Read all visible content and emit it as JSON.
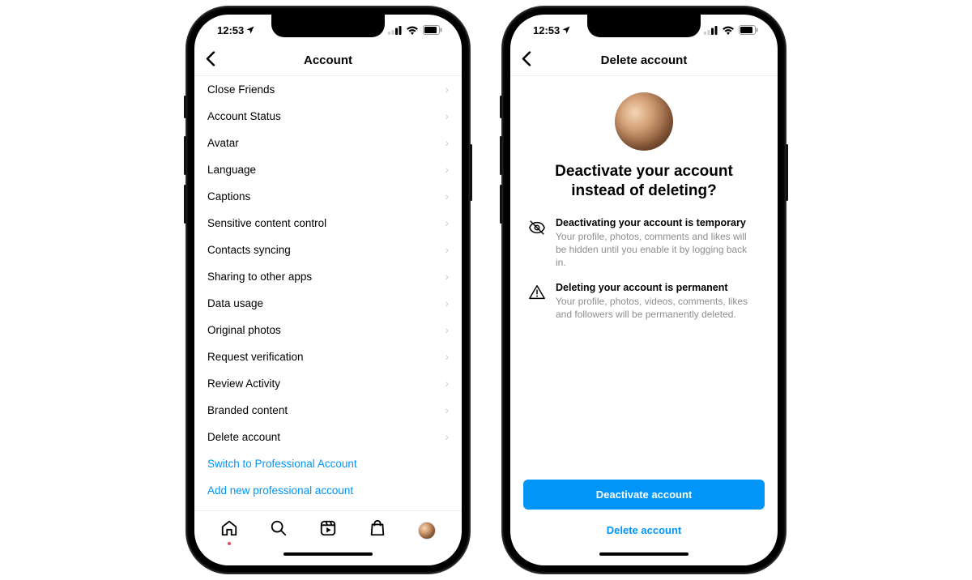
{
  "status": {
    "time": "12:53",
    "location_arrow": "➤"
  },
  "left": {
    "title": "Account",
    "items": [
      "Close Friends",
      "Account Status",
      "Avatar",
      "Language",
      "Captions",
      "Sensitive content control",
      "Contacts syncing",
      "Sharing to other apps",
      "Data usage",
      "Original photos",
      "Request verification",
      "Review Activity",
      "Branded content",
      "Delete account"
    ],
    "links": [
      "Switch to Professional Account",
      "Add new professional account"
    ]
  },
  "right": {
    "title": "Delete account",
    "headline": "Deactivate your account instead of deleting?",
    "info": [
      {
        "heading": "Deactivating your account is temporary",
        "body": "Your profile, photos, comments and likes will be hidden until you enable it by logging back in."
      },
      {
        "heading": "Deleting your account is permanent",
        "body": "Your profile, photos, videos, comments, likes and followers will be permanently deleted."
      }
    ],
    "primary_button": "Deactivate account",
    "secondary_button": "Delete account"
  }
}
